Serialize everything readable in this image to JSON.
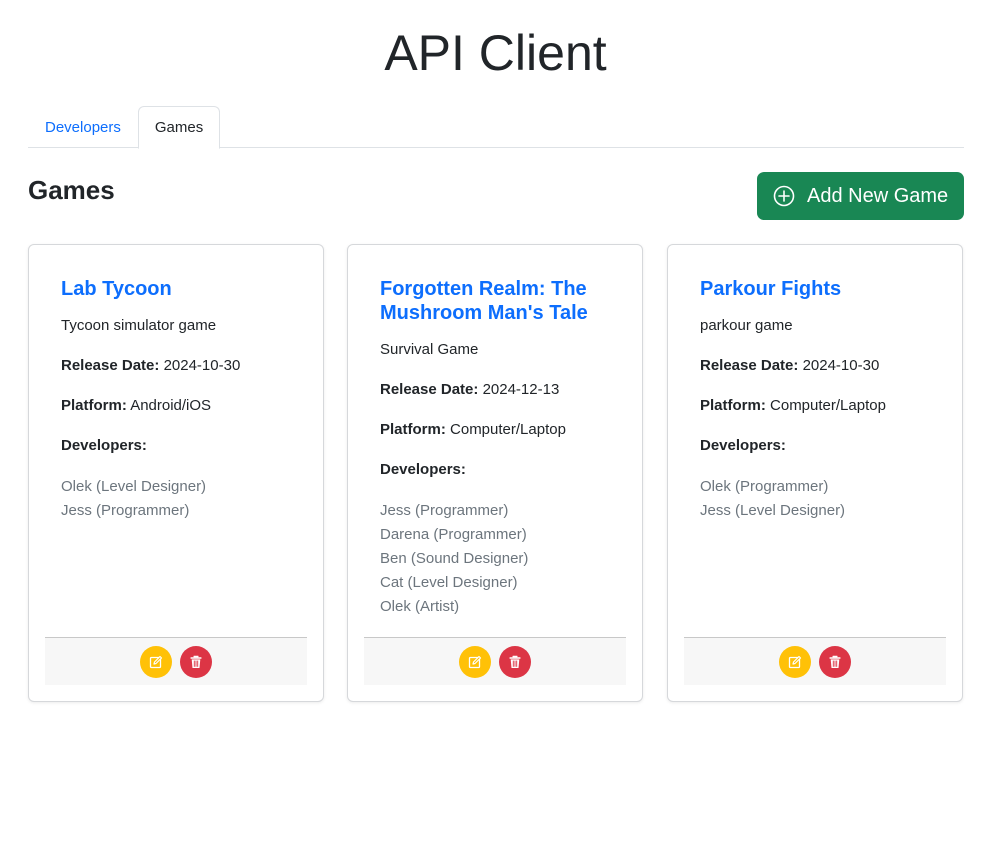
{
  "app": {
    "title": "API Client"
  },
  "tabs": [
    {
      "label": "Developers",
      "active": false
    },
    {
      "label": "Games",
      "active": true
    }
  ],
  "section": {
    "title": "Games",
    "add_button_label": "Add New Game"
  },
  "labels": {
    "release_date": "Release Date:",
    "platform": "Platform:",
    "developers": "Developers:"
  },
  "games": [
    {
      "title": "Lab Tycoon",
      "description": "Tycoon simulator game",
      "release_date": "2024-10-30",
      "platform": "Android/iOS",
      "developers": [
        "Olek (Level Designer)",
        "Jess (Programmer)"
      ]
    },
    {
      "title": "Forgotten Realm: The Mushroom Man's Tale",
      "description": "Survival Game",
      "release_date": "2024-12-13",
      "platform": "Computer/Laptop",
      "developers": [
        "Jess (Programmer)",
        "Darena (Programmer)",
        "Ben (Sound Designer)",
        "Cat (Level Designer)",
        "Olek (Artist)"
      ]
    },
    {
      "title": "Parkour Fights",
      "description": "parkour game",
      "release_date": "2024-10-30",
      "platform": "Computer/Laptop",
      "developers": [
        "Olek (Programmer)",
        "Jess (Level Designer)"
      ]
    }
  ],
  "colors": {
    "primary": "#0d6efd",
    "success": "#198754",
    "warning": "#ffc107",
    "danger": "#dc3545",
    "muted": "#6c757d"
  },
  "icons": {
    "add": "plus-circle-icon",
    "edit": "edit-icon",
    "delete": "trash-icon"
  }
}
